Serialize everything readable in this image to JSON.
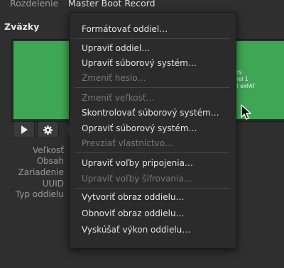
{
  "header": {
    "partitioning_label": "Rozdelenie",
    "partitioning_value": "Master Boot Record"
  },
  "volumes": {
    "title": "Zväzky"
  },
  "partition": {
    "line1": "toy",
    "line2": "diel 1",
    "line3": "el exFAT"
  },
  "properties": {
    "size": "Veľkosť",
    "contents": "Obsah",
    "device": "Zariadenie",
    "uuid": "UUID",
    "type": "Typ oddielu"
  },
  "menu": {
    "format": "Formátovať oddiel…",
    "edit_partition": "Upraviť oddiel…",
    "edit_filesystem": "Upraviť súborový systém…",
    "change_passphrase": "Zmeniť heslo…",
    "resize": "Zmeniť veľkosť…",
    "check_filesystem": "Skontrolovať súborový systém…",
    "repair_filesystem": "Opraviť súborový systém…",
    "take_ownership": "Prevziať vlastníctvo…",
    "edit_mount_options": "Upraviť voľby pripojenia…",
    "edit_encryption_options": "Upraviť voľby šifrovania…",
    "create_image": "Vytvoriť obraz oddielu…",
    "restore_image": "Obnoviť obraz oddielu…",
    "benchmark": "Vyskúšať výkon oddielu…"
  },
  "colors": {
    "partition_fill": "#3fa655",
    "menu_bg": "#2b2b2b",
    "disabled_text": "#777777"
  },
  "icons": {
    "play": "play-icon",
    "gear": "gear-icon",
    "cursor": "mouse-pointer-icon"
  }
}
